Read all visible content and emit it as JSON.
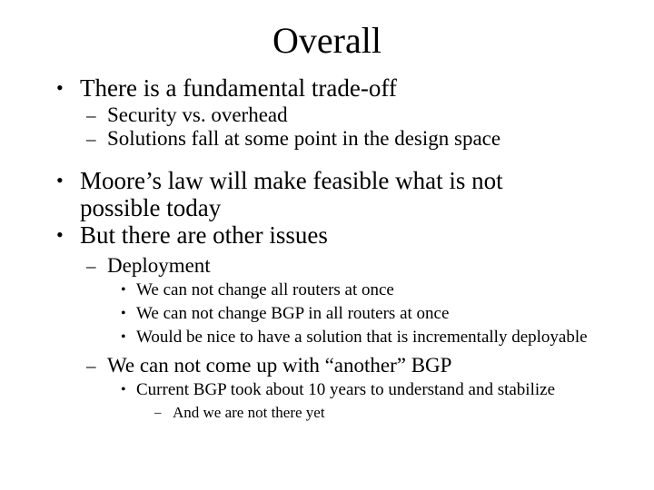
{
  "slide": {
    "title": "Overall",
    "background_color": "#ffffff",
    "text_color": "#000000",
    "markers": {
      "level1": "•",
      "level2": "–",
      "level3": "•",
      "level4": "–"
    },
    "bullets": [
      {
        "level": 1,
        "text": "There is a fundamental trade-off"
      },
      {
        "level": 2,
        "text": "Security vs. overhead"
      },
      {
        "level": 2,
        "text": "Solutions fall at some point in the design space"
      },
      {
        "level": 1,
        "text": "Moore’s law will make feasible what is not possible today"
      },
      {
        "level": 1,
        "text": "But there are other issues"
      },
      {
        "level": 2,
        "text": "Deployment"
      },
      {
        "level": 3,
        "text": "We can not change all routers at once"
      },
      {
        "level": 3,
        "text": "We can not change BGP in all routers at once"
      },
      {
        "level": 3,
        "text": "Would be nice to have a solution that is incrementally deployable"
      },
      {
        "level": 2,
        "text": "We can not come up with “another” BGP"
      },
      {
        "level": 3,
        "text": "Current BGP took about 10 years to understand and stabilize"
      },
      {
        "level": 4,
        "text": "And we are not there yet"
      }
    ]
  }
}
